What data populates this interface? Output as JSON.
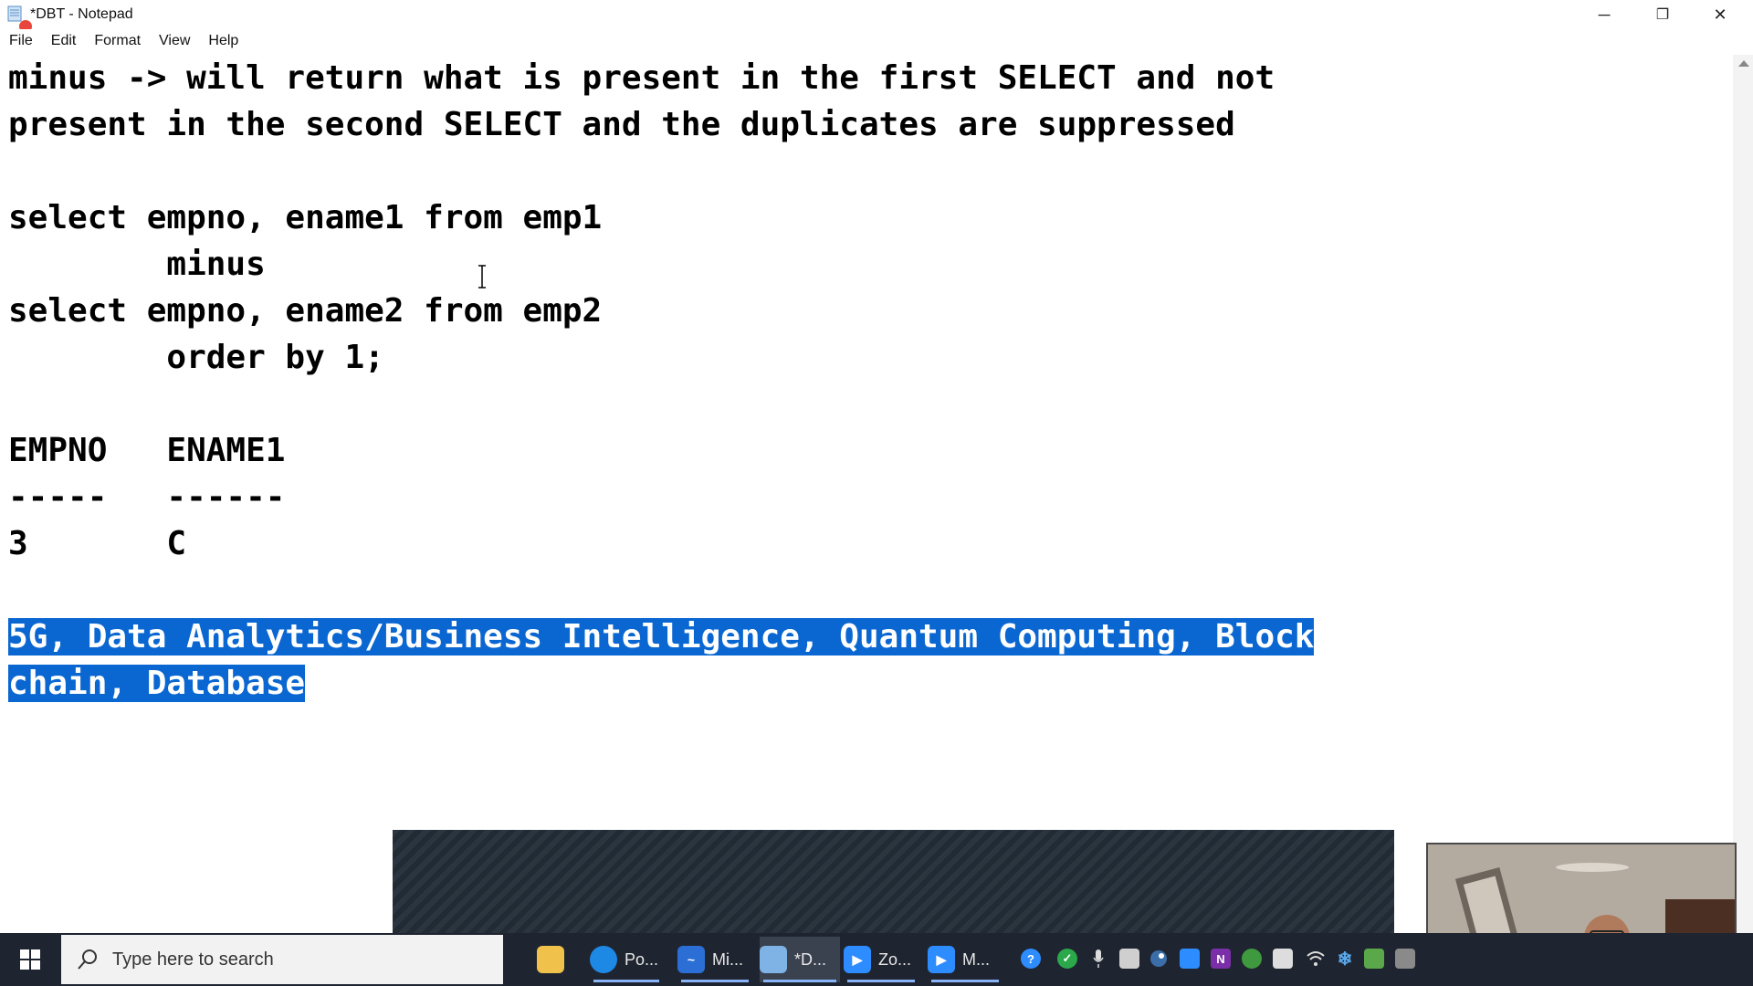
{
  "window": {
    "title": "*DBT - Notepad",
    "controls": {
      "minimize": "─",
      "restore": "❐",
      "close": "✕"
    }
  },
  "menu": [
    "File",
    "Edit",
    "Format",
    "View",
    "Help"
  ],
  "editor": {
    "lines": [
      "minus -> will return what is present in the first SELECT and not",
      "present in the second SELECT and the duplicates are suppressed",
      "",
      "select empno, ename1 from emp1",
      "        minus",
      "select empno, ename2 from emp2",
      "        order by 1;",
      "",
      "EMPNO   ENAME1",
      "-----   ------",
      "3       C",
      "",
      "5G, Data Analytics/Business Intelligence, Quantum Computing, Block",
      "chain, Database"
    ],
    "selected_lines": [
      12,
      13
    ],
    "selection_color": "#0a67d1"
  },
  "taskbar": {
    "search_placeholder": "Type here to search",
    "apps": [
      {
        "name": "file-explorer",
        "label": "",
        "color": "#f0c24b"
      },
      {
        "name": "edge",
        "label": "Po...",
        "color": "#1e88e5"
      },
      {
        "name": "whiteboard",
        "label": "Mi...",
        "color": "#2b6fd6"
      },
      {
        "name": "notepad",
        "label": "*D...",
        "color": "#7fb3e6"
      },
      {
        "name": "zoom",
        "label": "Zo...",
        "color": "#2d8cff"
      },
      {
        "name": "zoom-meeting",
        "label": "M...",
        "color": "#2d8cff"
      }
    ]
  }
}
